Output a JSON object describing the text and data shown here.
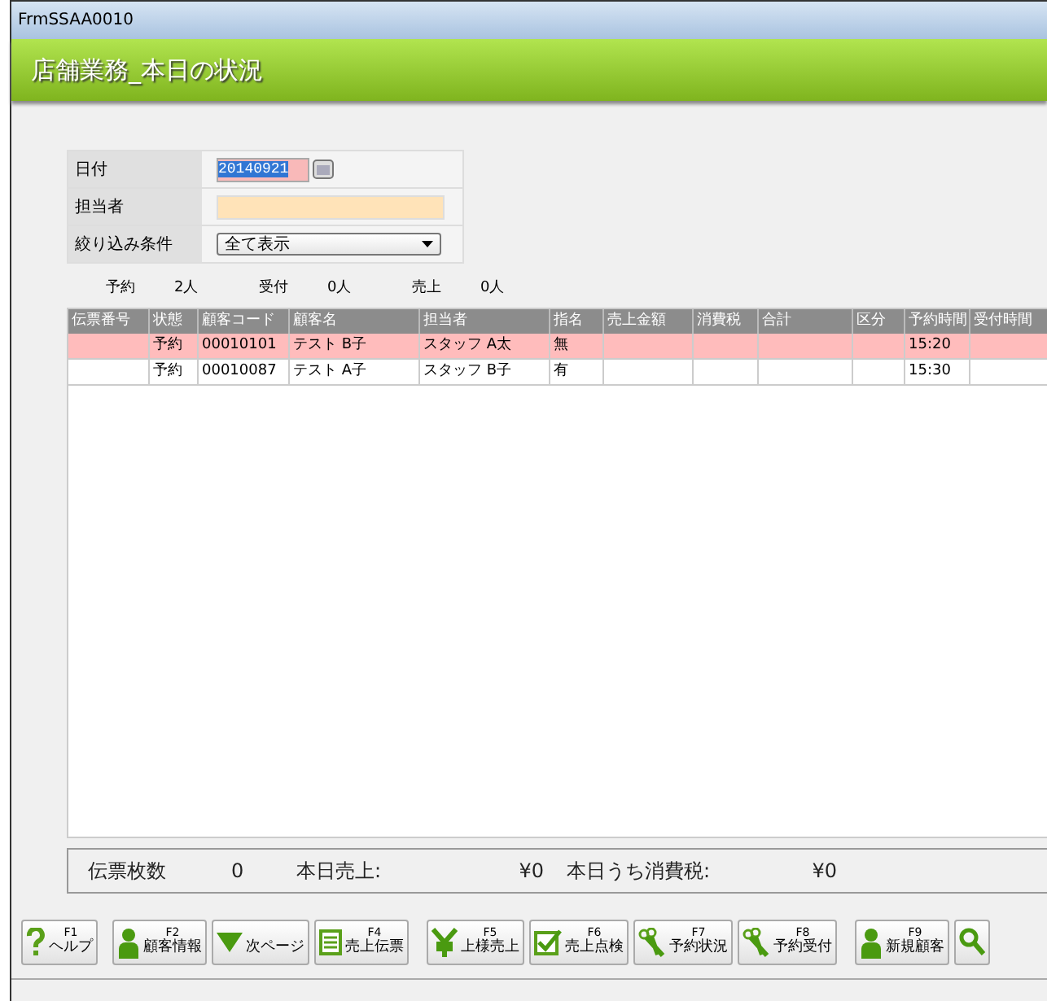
{
  "window": {
    "title": "FrmSSAA0010"
  },
  "header": {
    "title": "店舗業務_本日の状況"
  },
  "form": {
    "rows": [
      {
        "label": "日付",
        "kind": "date",
        "value": "20140921"
      },
      {
        "label": "担当者",
        "kind": "text"
      },
      {
        "label": "絞り込み条件",
        "kind": "select",
        "value": "全て表示"
      }
    ]
  },
  "counts": [
    {
      "label": "予約",
      "value": "2人"
    },
    {
      "label": "受付",
      "value": "0人"
    },
    {
      "label": "売上",
      "value": "0人"
    }
  ],
  "table": {
    "columns": [
      "伝票番号",
      "状態",
      "顧客コード",
      "顧客名",
      "担当者",
      "指名",
      "売上金額",
      "消費税",
      "合計",
      "区分",
      "予約時間",
      "受付時間"
    ],
    "rows": [
      {
        "selected": true,
        "cells": [
          "",
          "予約",
          "00010101",
          "テスト B子",
          "スタッフ  A太",
          "無",
          "",
          "",
          "",
          "",
          "15:20",
          ""
        ]
      },
      {
        "selected": false,
        "cells": [
          "",
          "予約",
          "00010087",
          "テスト A子",
          "スタッフ  B子",
          "有",
          "",
          "",
          "",
          "",
          "15:30",
          ""
        ]
      }
    ]
  },
  "summary": [
    {
      "label": "伝票枚数",
      "value": "0"
    },
    {
      "label": "本日売上:",
      "value": "¥0"
    },
    {
      "label": "本日うち消費税:",
      "value": "¥0"
    }
  ],
  "buttons": [
    {
      "key": "F1",
      "label": "ヘルプ",
      "kind": "help"
    },
    {
      "key": "F2",
      "label": "顧客情報",
      "kind": "person"
    },
    {
      "label": "次ページ",
      "kind": "down"
    },
    {
      "key": "F4",
      "label": "売上伝票",
      "kind": "list"
    },
    {
      "key": "F5",
      "label": "上様売上",
      "kind": "yen"
    },
    {
      "key": "F6",
      "label": "売上点検",
      "kind": "check"
    },
    {
      "key": "F7",
      "label": "予約状況",
      "kind": "scissors"
    },
    {
      "key": "F8",
      "label": "予約受付",
      "kind": "scissors"
    },
    {
      "key": "F9",
      "label": "新規顧客",
      "kind": "person"
    },
    {
      "kind": "search"
    }
  ]
}
